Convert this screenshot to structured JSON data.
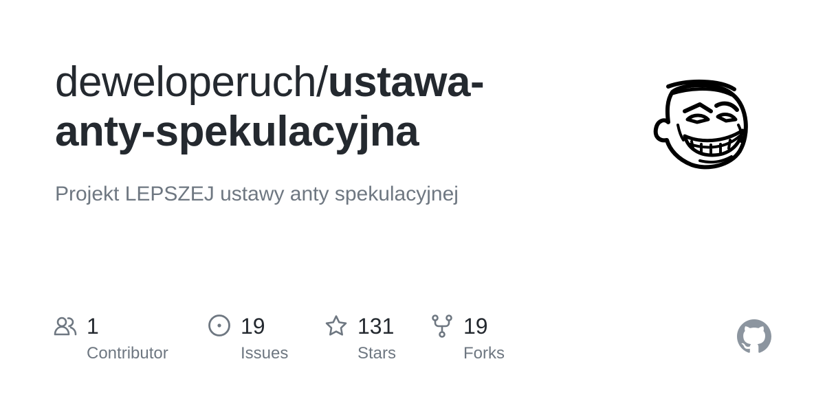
{
  "repo": {
    "owner": "deweloperuch/",
    "name": "ustawa-anty-spekulacyjna",
    "description": "Projekt LEPSZEJ ustawy anty spekulacyjnej"
  },
  "avatar": {
    "icon": "troll-face-avatar"
  },
  "stats": [
    {
      "value": "1",
      "label": "Contributor",
      "icon": "people-icon"
    },
    {
      "value": "19",
      "label": "Issues",
      "icon": "issue-opened-icon"
    },
    {
      "value": "131",
      "label": "Stars",
      "icon": "star-icon"
    },
    {
      "value": "19",
      "label": "Forks",
      "icon": "repo-forked-icon"
    }
  ],
  "colors": {
    "title": "#24292f",
    "muted": "#6e7781",
    "github_mark": "#8c959f"
  },
  "branding": {
    "icon": "github-mark-icon"
  }
}
